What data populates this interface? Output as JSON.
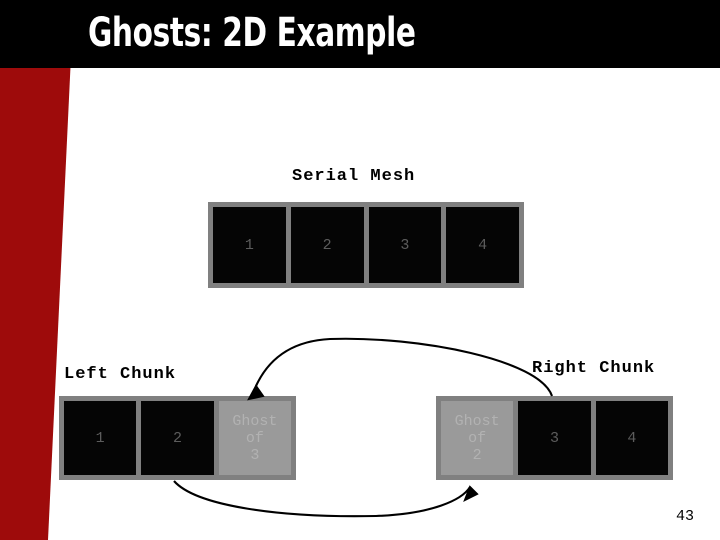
{
  "slide": {
    "title": "Ghosts: 2D Example",
    "page_number": "43",
    "colors": {
      "title_bar": "#000000",
      "accent_band": "#9E0B0B",
      "frame_gray": "#808080",
      "real_cell": "#050505",
      "real_cell_text": "#5c5c5c",
      "ghost_cell": "#9a9a9a",
      "ghost_cell_text": "#b2b2b2",
      "background": "#ffffff"
    }
  },
  "serial_mesh": {
    "label": "Serial Mesh",
    "cells": [
      {
        "lines": [
          "1"
        ],
        "kind": "real"
      },
      {
        "lines": [
          "2"
        ],
        "kind": "real"
      },
      {
        "lines": [
          "3"
        ],
        "kind": "real"
      },
      {
        "lines": [
          "4"
        ],
        "kind": "real"
      }
    ]
  },
  "left_chunk": {
    "label": "Left Chunk",
    "cells": [
      {
        "lines": [
          "1"
        ],
        "kind": "real"
      },
      {
        "lines": [
          "2"
        ],
        "kind": "real"
      },
      {
        "lines": [
          "Ghost",
          "of",
          "3"
        ],
        "kind": "ghost"
      }
    ]
  },
  "right_chunk": {
    "label": "Right Chunk",
    "cells": [
      {
        "lines": [
          "Ghost",
          "of",
          "2"
        ],
        "kind": "ghost"
      },
      {
        "lines": [
          "3"
        ],
        "kind": "real"
      },
      {
        "lines": [
          "4"
        ],
        "kind": "real"
      }
    ]
  },
  "arrows": [
    {
      "name": "arrow-right3-to-left-ghost3",
      "from": "right chunk cell 3",
      "to": "left chunk Ghost of 3"
    },
    {
      "name": "arrow-left2-to-right-ghost2",
      "from": "left chunk cell 2",
      "to": "right chunk Ghost of 2"
    }
  ]
}
